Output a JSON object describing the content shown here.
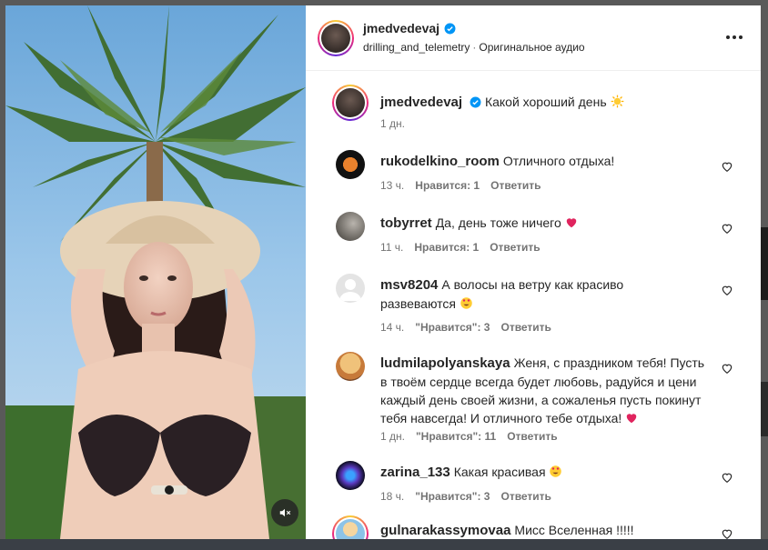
{
  "post": {
    "author": "jmedvedevaj",
    "audio_author": "drilling_and_telemetry",
    "audio_label": "Оригинальное аудио",
    "caption": "Какой хороший день",
    "caption_time": "1 дн."
  },
  "comments": [
    {
      "user": "rukodelkino_room",
      "text": "Отличного отдыха!",
      "time": "13 ч.",
      "likes": "Нравится: 1",
      "reply": "Ответить"
    },
    {
      "user": "tobyrret",
      "text": "Да, день тоже ничего",
      "time": "11 ч.",
      "likes": "Нравится: 1",
      "reply": "Ответить"
    },
    {
      "user": "msv8204",
      "text": "А волосы на ветру как красиво развеваются",
      "time": "14 ч.",
      "likes": "\"Нравится\": 3",
      "reply": "Ответить"
    },
    {
      "user": "ludmilapolyanskaya",
      "text": "Женя, с праздником тебя! Пусть в твоём сердце всегда будет любовь, радуйся и цени каждый день своей жизни, а сожаленья пусть покинут тебя навсегда! И отличного тебе отдыха!",
      "time": "1 дн.",
      "likes": "\"Нравится\": 11",
      "reply": "Ответить"
    },
    {
      "user": "zarina_133",
      "text": "Какая красивая",
      "time": "18 ч.",
      "likes": "\"Нравится\": 3",
      "reply": "Ответить"
    },
    {
      "user": "gulnarakassymovaa",
      "text": "Мисс Вселенная !!!!!"
    }
  ],
  "colors": {
    "verified": "#0095f6",
    "heart_emoji": "#e0245e",
    "text_secondary": "#737373"
  },
  "icons": [
    "verified-icon",
    "more-icon",
    "heart-outline-icon",
    "mute-icon",
    "sun-emoji",
    "heart-emoji",
    "heart-eyes-emoji"
  ]
}
